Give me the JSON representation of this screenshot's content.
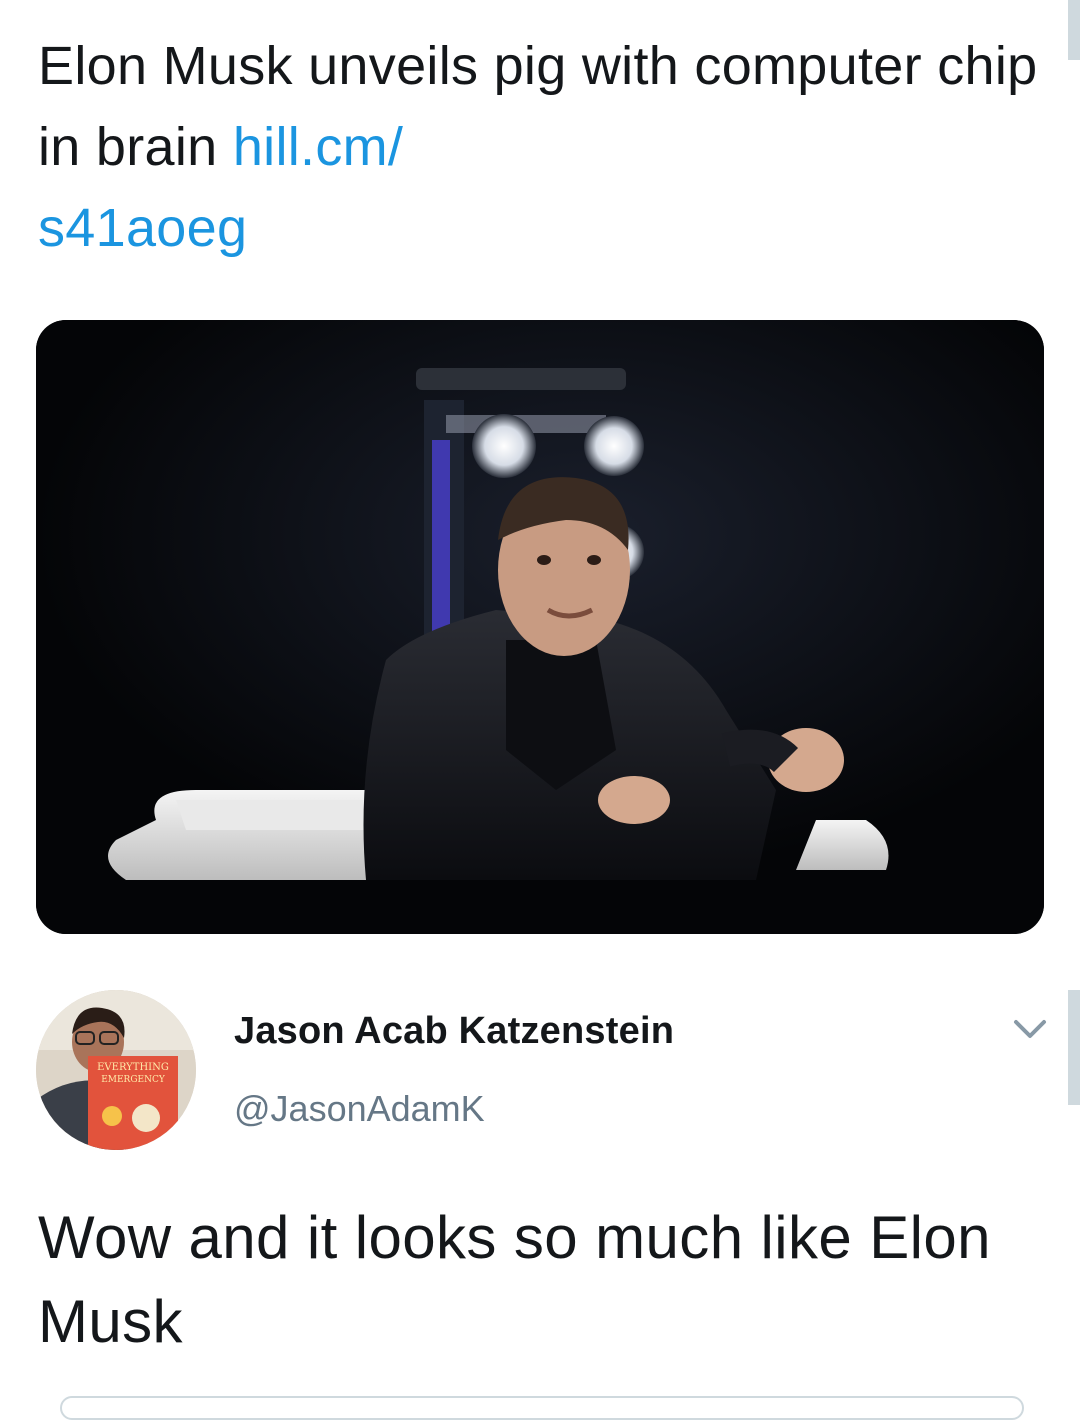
{
  "quoted_tweet": {
    "text": "Elon Musk unveils pig with computer chip in brain",
    "link": "hill.cm/s41aoeg",
    "link_line1": "hill.cm/",
    "link_line2": "s41aoeg"
  },
  "media": {
    "alt": "Photo of Elon Musk seated on a white chair on a dark stage, gesturing while speaking"
  },
  "reply_tweet": {
    "author_name": "Jason Acab Katzenstein",
    "author_handle": "@JasonAdamK",
    "avatar_book_title_1": "EVERYTHING",
    "avatar_book_title_2": "EMERGENCY",
    "text": "Wow and it looks so much like Elon Musk"
  },
  "icons": {
    "menu": "chevron-down-icon"
  },
  "colors": {
    "link": "#1b95e0",
    "text": "#14171a",
    "secondary": "#657786"
  }
}
